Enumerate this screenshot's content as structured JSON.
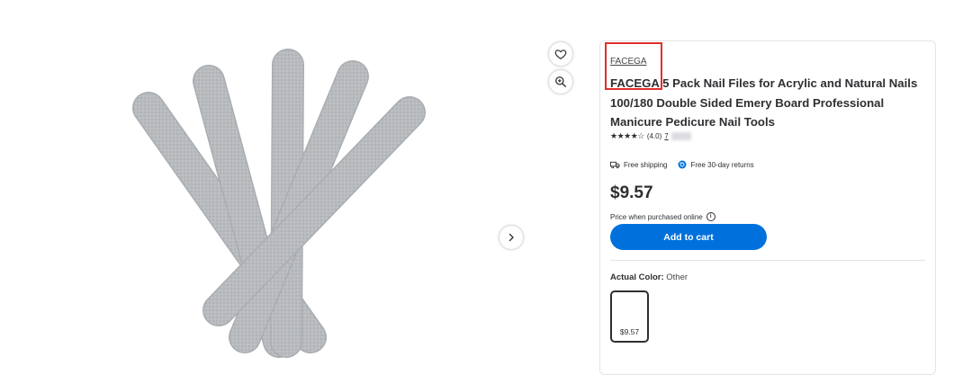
{
  "product": {
    "brand": "FACEGA",
    "title": "FACEGA 5 Pack Nail Files for Acrylic and Natural Nails 100/180 Double Sided Emery Board Professional Manicure Pedicure Nail Tools",
    "rating_stars": "★★★★☆",
    "rating_value": "(4.0)",
    "reviews_count": "7",
    "shipping": "Free shipping",
    "returns": "Free 30-day returns",
    "price": "$9.57",
    "price_note": "Price when purchased online",
    "add_to_cart_label": "Add to cart",
    "variant": {
      "label": "Actual Color:",
      "value": "Other",
      "options": [
        {
          "price": "$9.57"
        }
      ]
    }
  },
  "colors": {
    "accent": "#0071dc",
    "highlight": "#e0302e",
    "nail_file": "#b8bcbf"
  }
}
